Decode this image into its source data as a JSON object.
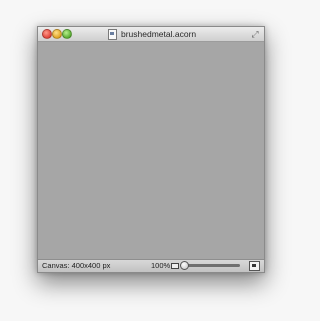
{
  "window": {
    "title": "brushedmetal.acorn"
  },
  "status": {
    "canvas_size": "Canvas: 400x400 px",
    "zoom": "100%",
    "zoom_level": 0.0
  },
  "icons": {
    "document": "document-icon",
    "resize": "resize-grip-icon",
    "zoom_image": "image-size-icon",
    "fit": "fit-window-icon"
  },
  "colors": {
    "canvas_background": "#a6a6a6",
    "close": "#e0443a",
    "minimize": "#e0a324",
    "zoom": "#5aad33"
  }
}
